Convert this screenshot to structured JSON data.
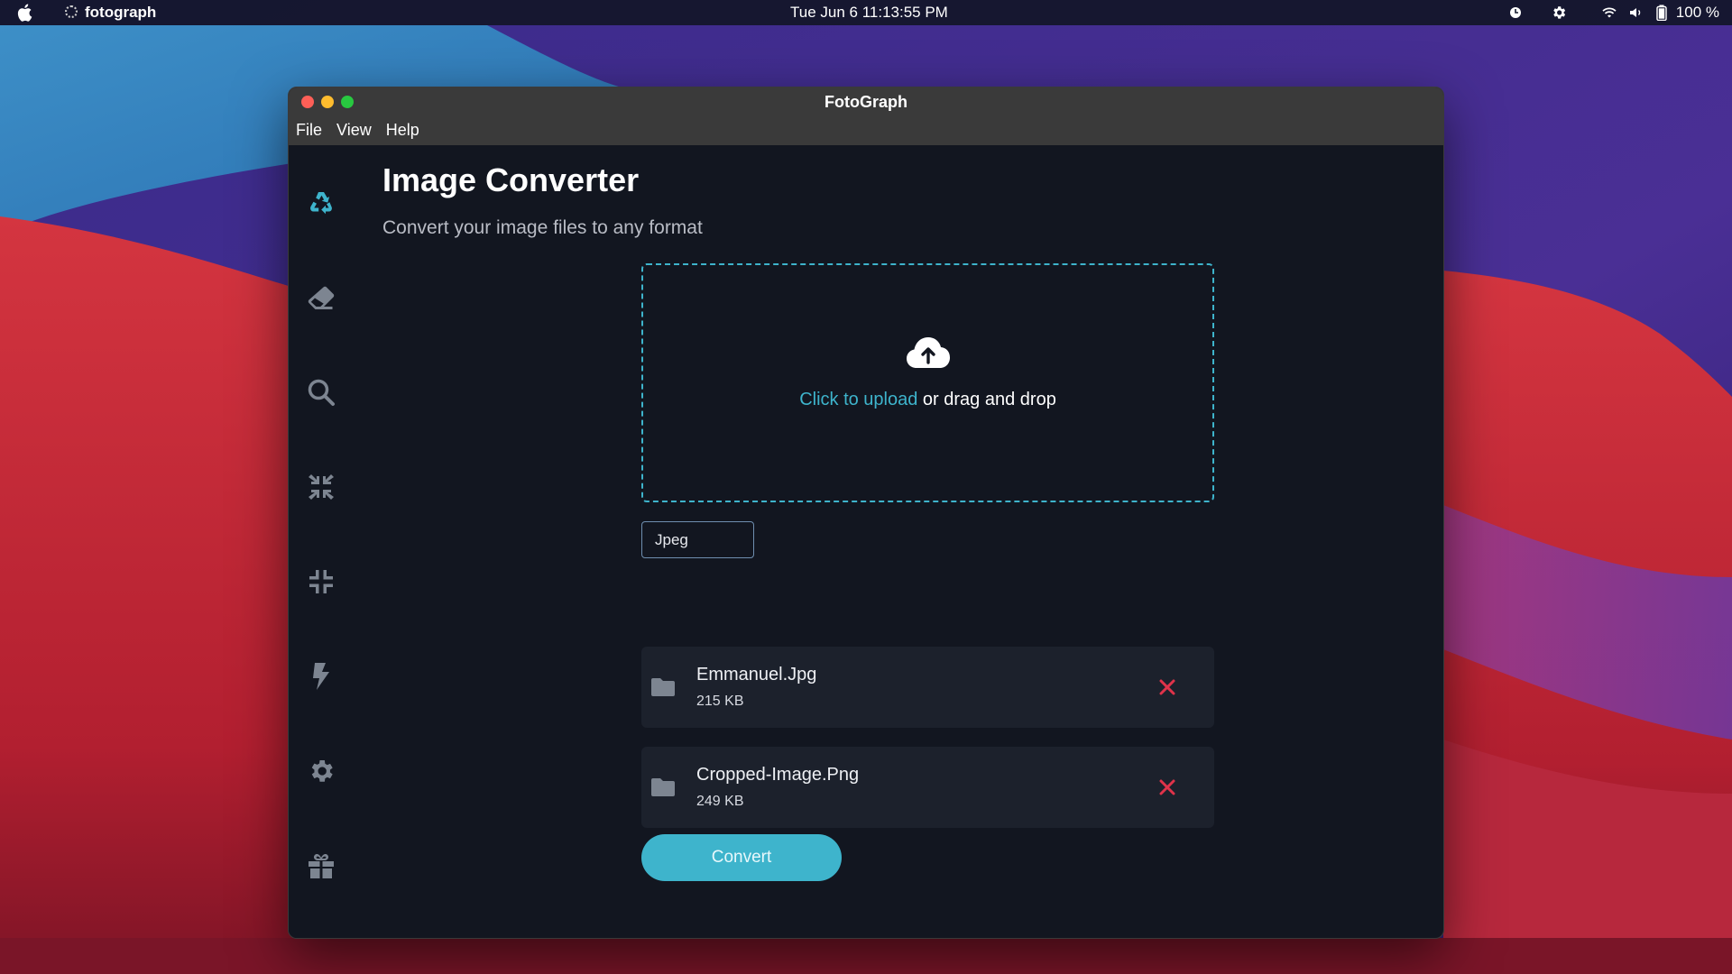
{
  "menubar": {
    "app_name": "fotograph",
    "clock": "Tue Jun 6  11:13:55 PM",
    "battery": "100 %",
    "icons": [
      "apple-icon",
      "clock-icon",
      "settings-icon",
      "wifi-icon",
      "volume-icon",
      "battery-icon"
    ]
  },
  "window": {
    "title": "FotoGraph",
    "menu": [
      "File",
      "View",
      "Help"
    ]
  },
  "sidebar": {
    "items": [
      {
        "icon": "recycle-icon",
        "active": true
      },
      {
        "icon": "eraser-icon",
        "active": false
      },
      {
        "icon": "search-icon",
        "active": false
      },
      {
        "icon": "compress-icon",
        "active": false
      },
      {
        "icon": "minimize-icon",
        "active": false
      },
      {
        "icon": "bolt-icon",
        "active": false
      },
      {
        "icon": "gear-icon",
        "active": false
      },
      {
        "icon": "gift-icon",
        "active": false
      }
    ]
  },
  "main": {
    "title": "Image Converter",
    "subtitle": "Convert your image files to any format",
    "dropzone": {
      "link_text": "Click to upload",
      "rest_text": " or drag and drop"
    },
    "format": "Jpeg",
    "files": [
      {
        "name": "Emmanuel.Jpg",
        "size": "215 KB"
      },
      {
        "name": "Cropped-Image.Png",
        "size": "249 KB"
      }
    ],
    "convert_label": "Convert"
  },
  "colors": {
    "accent": "#3eb4cc",
    "danger": "#e0334a",
    "window_bg": "#121620",
    "row_bg": "#1c212c"
  }
}
